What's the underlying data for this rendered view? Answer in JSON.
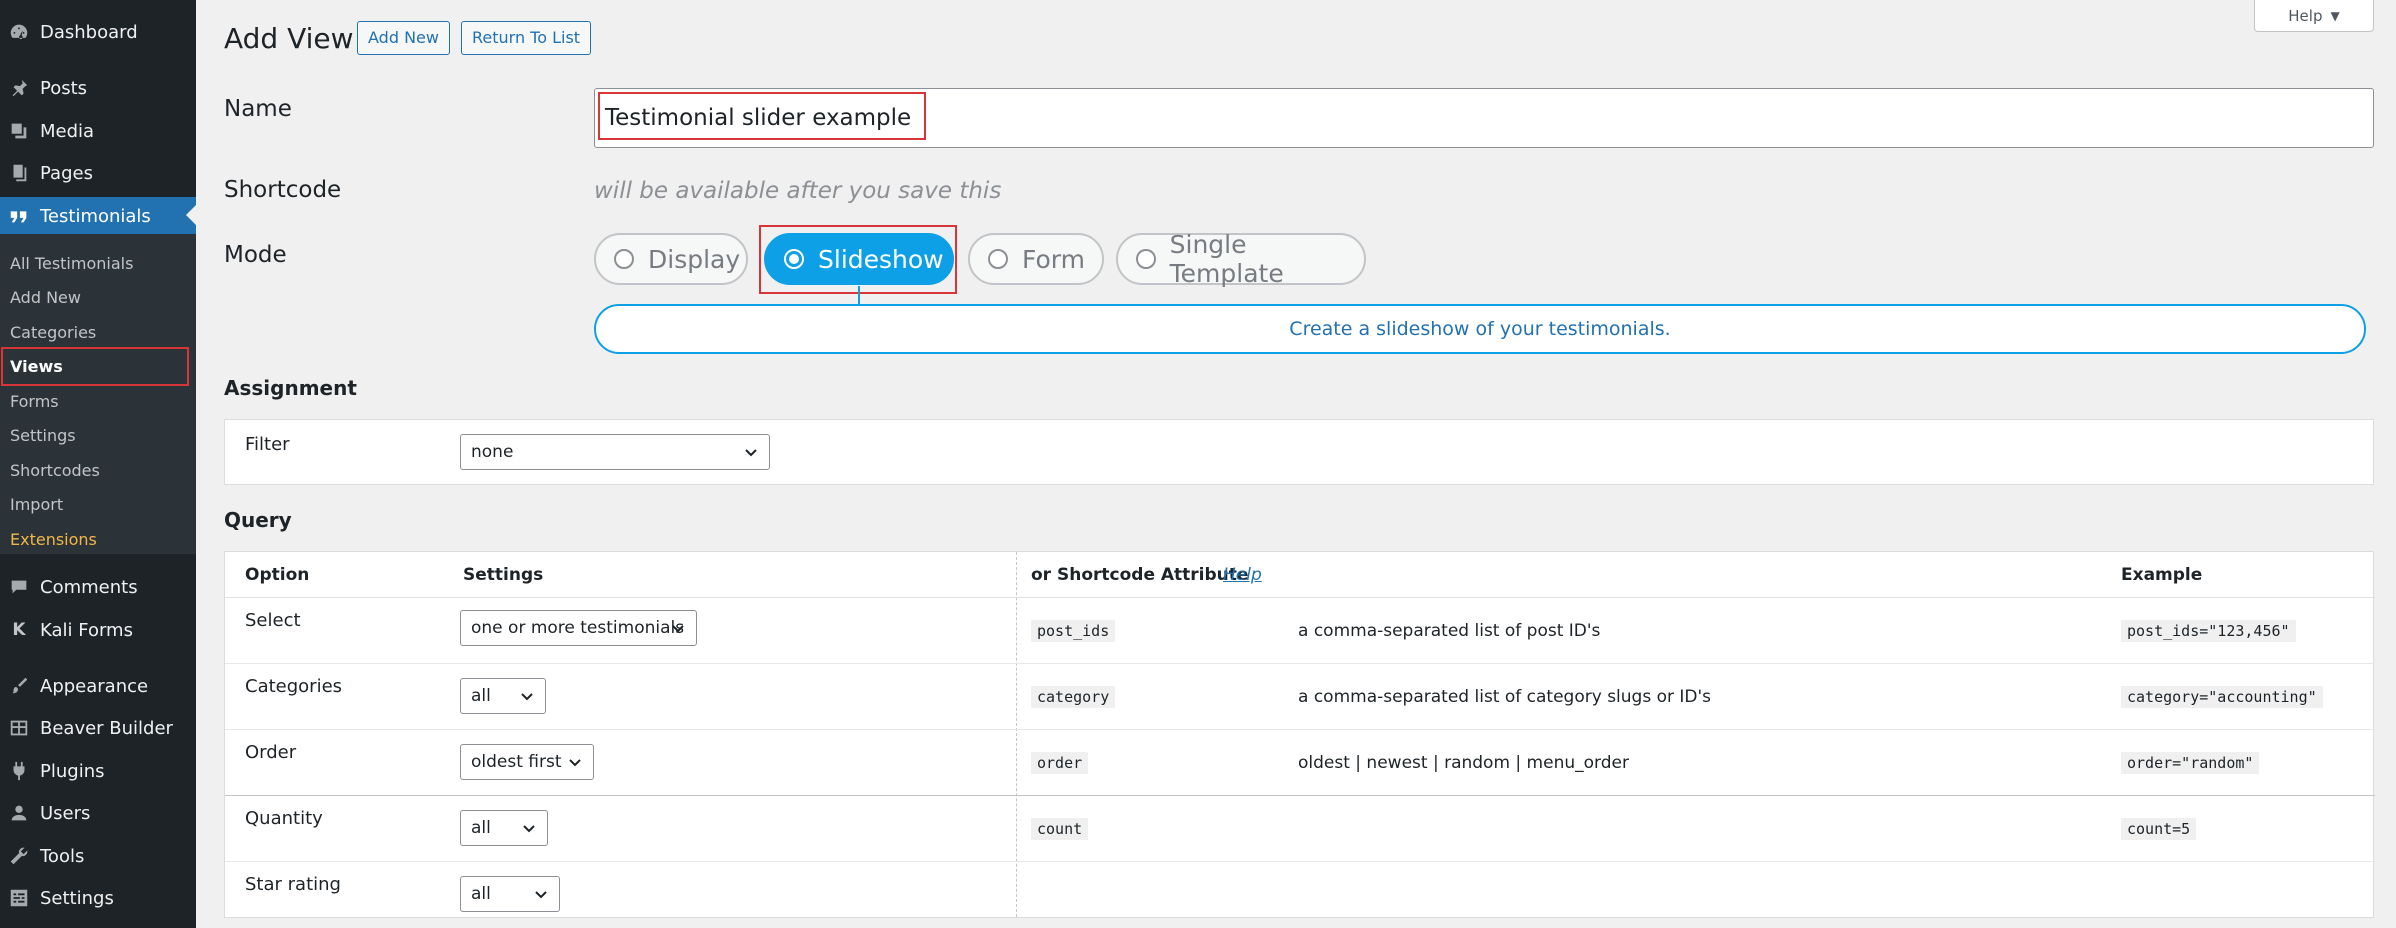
{
  "sidebar": {
    "items": [
      {
        "label": "Dashboard",
        "icon": "dashboard-icon"
      },
      {
        "label": "Posts",
        "icon": "pin-icon"
      },
      {
        "label": "Media",
        "icon": "media-icon"
      },
      {
        "label": "Pages",
        "icon": "pages-icon"
      },
      {
        "label": "Testimonials",
        "icon": "quote-icon"
      },
      {
        "label": "Comments",
        "icon": "comment-icon"
      },
      {
        "label": "Kali Forms",
        "icon": "kali-forms-icon"
      },
      {
        "label": "Appearance",
        "icon": "brush-icon"
      },
      {
        "label": "Beaver Builder",
        "icon": "grid-icon"
      },
      {
        "label": "Plugins",
        "icon": "plugin-icon"
      },
      {
        "label": "Users",
        "icon": "user-icon"
      },
      {
        "label": "Tools",
        "icon": "wrench-icon"
      },
      {
        "label": "Settings",
        "icon": "settings-icon"
      }
    ],
    "kali_letter": "K",
    "submenu": [
      "All Testimonials",
      "Add New",
      "Categories",
      "Views",
      "Forms",
      "Settings",
      "Shortcodes",
      "Import",
      "Extensions"
    ]
  },
  "header": {
    "title": "Add View",
    "add_new": "Add New",
    "return_to_list": "Return To List",
    "help": "Help"
  },
  "form": {
    "name_label": "Name",
    "name_value": "Testimonial slider example",
    "shortcode_label": "Shortcode",
    "shortcode_note": "will be available after you save this",
    "mode_label": "Mode",
    "modes": [
      "Display",
      "Slideshow",
      "Form",
      "Single Template"
    ],
    "selected_mode": "Slideshow",
    "mode_description": "Create a slideshow of your testimonials."
  },
  "assignment": {
    "title": "Assignment",
    "filter_label": "Filter",
    "filter_value": "none"
  },
  "query": {
    "title": "Query",
    "headers": {
      "option": "Option",
      "settings": "Settings",
      "attribute": "or Shortcode Attribute",
      "help": "Help",
      "example": "Example"
    },
    "rows": [
      {
        "option": "Select",
        "setting": "one or more testimonials",
        "attribute": "post_ids",
        "description": "a comma-separated list of post ID's",
        "example": "post_ids=\"123,456\""
      },
      {
        "option": "Categories",
        "setting": "all",
        "attribute": "category",
        "description": "a comma-separated list of category slugs or ID's",
        "example": "category=\"accounting\""
      },
      {
        "option": "Order",
        "setting": "oldest first",
        "attribute": "order",
        "description": "oldest | newest | random | menu_order",
        "example": "order=\"random\""
      },
      {
        "option": "Quantity",
        "setting": "all",
        "attribute": "count",
        "description": "",
        "example": "count=5"
      },
      {
        "option": "Star rating",
        "setting": "all",
        "attribute": "",
        "description": "",
        "example": ""
      }
    ]
  },
  "colors": {
    "sidebar_bg": "#1d2327",
    "active_bg": "#2271b1",
    "highlight": "#d63638",
    "slideshow": "#0ea0e6"
  }
}
